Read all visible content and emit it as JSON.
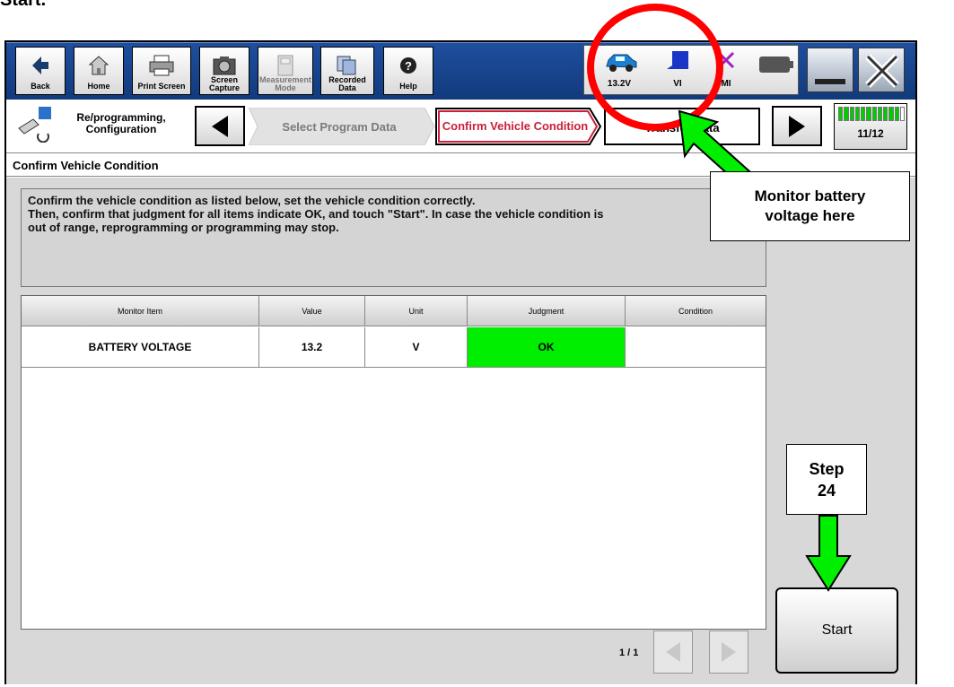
{
  "caption": {
    "text": "Start."
  },
  "toolbar": {
    "buttons": [
      {
        "label": "Back",
        "icon": "back-arrow-icon"
      },
      {
        "label": "Home",
        "icon": "home-icon"
      },
      {
        "label": "Print Screen",
        "icon": "printer-icon"
      },
      {
        "label": "Screen Capture",
        "icon": "camera-icon"
      },
      {
        "label": "Measurement Mode",
        "icon": "meter-icon",
        "disabled": true
      },
      {
        "label": "Recorded Data",
        "icon": "recorded-data-icon"
      },
      {
        "label": "Help",
        "icon": "help-icon"
      }
    ],
    "status": {
      "battery_voltage": "13.2V",
      "vi_label": "VI",
      "mi_label": "MI"
    }
  },
  "nav": {
    "section_label": "Re/programming, Configuration",
    "steps": [
      {
        "label": "Select Program Data",
        "state": "inactive"
      },
      {
        "label": "Confirm Vehicle Condition",
        "state": "active"
      },
      {
        "label": "Transfer Data",
        "state": "pending"
      }
    ],
    "progress": "11/12",
    "progress_fraction": 0.92
  },
  "screen": {
    "title": "Confirm Vehicle Condition",
    "instructions": [
      "Confirm the vehicle condition as listed below, set the vehicle condition correctly.",
      "Then, confirm that judgment for all items indicate OK, and touch \"Start\". In case the vehicle condition is",
      "out of range, reprogramming or programming may stop."
    ]
  },
  "table": {
    "headers": [
      "Monitor Item",
      "Value",
      "Unit",
      "Judgment",
      "Condition"
    ],
    "rows": [
      {
        "item": "BATTERY VOLTAGE",
        "value": "13.2",
        "unit": "V",
        "judgment": "OK",
        "condition": ""
      }
    ]
  },
  "pagination": {
    "label": "1 / 1"
  },
  "start_button": {
    "label": "Start"
  },
  "callouts": {
    "battery": "Monitor battery voltage here",
    "step": "Step 24"
  },
  "colors": {
    "ok_green": "#00ee00",
    "annotation_red": "#ff0000",
    "arrow_green": "#00ee00",
    "active_step": "#cc1f3a",
    "progress_green": "#00cc00"
  }
}
